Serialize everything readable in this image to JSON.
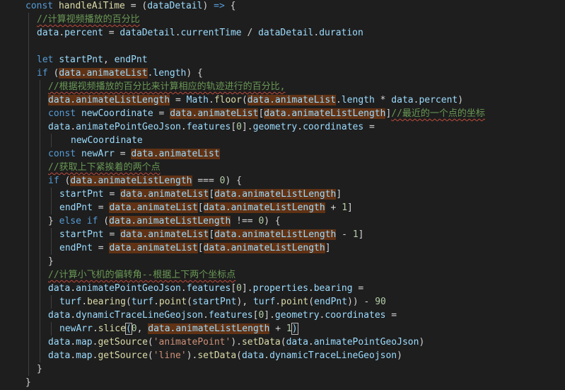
{
  "editor": {
    "theme_colors": {
      "background": "#1e1e1e",
      "keyword": "#569cd6",
      "function": "#dcdcaa",
      "variable": "#9cdcfe",
      "comment": "#6a9955",
      "string": "#ce9178",
      "number": "#b5cea8",
      "highlight": "#613214"
    },
    "lines": [
      {
        "indent": 0,
        "tokens": [
          [
            "kw",
            "const "
          ],
          [
            "fn",
            "handleAiTime"
          ],
          [
            "op",
            " = ("
          ],
          [
            "var",
            "dataDetail"
          ],
          [
            "op",
            ") "
          ],
          [
            "kw",
            "=>"
          ],
          [
            "op",
            " {"
          ]
        ]
      },
      {
        "indent": 1,
        "tokens": [
          [
            "cm",
            "//计算视频播放的百分比"
          ]
        ]
      },
      {
        "indent": 1,
        "tokens": [
          [
            "var",
            "data"
          ],
          [
            "op",
            "."
          ],
          [
            "prop",
            "percent"
          ],
          [
            "op",
            " = "
          ],
          [
            "var",
            "dataDetail"
          ],
          [
            "op",
            "."
          ],
          [
            "prop",
            "currentTime"
          ],
          [
            "op",
            " / "
          ],
          [
            "var",
            "dataDetail"
          ],
          [
            "op",
            "."
          ],
          [
            "prop",
            "duration"
          ]
        ]
      },
      {
        "indent": 1,
        "tokens": []
      },
      {
        "indent": 1,
        "tokens": [
          [
            "kw",
            "let "
          ],
          [
            "var",
            "startPnt"
          ],
          [
            "op",
            ", "
          ],
          [
            "var",
            "endPnt"
          ]
        ]
      },
      {
        "indent": 1,
        "tokens": [
          [
            "kw",
            "if"
          ],
          [
            "op",
            " ("
          ],
          [
            "hl",
            "data.animateList"
          ],
          [
            "op",
            "."
          ],
          [
            "prop",
            "length"
          ],
          [
            "op",
            ") {"
          ]
        ]
      },
      {
        "indent": 2,
        "tokens": [
          [
            "cm",
            "//根据视频播放的百分比来计算相应的轨迹进行的百分比,"
          ]
        ]
      },
      {
        "indent": 2,
        "tokens": [
          [
            "hl",
            "data.animateListLength"
          ],
          [
            "op",
            " = "
          ],
          [
            "var",
            "Math"
          ],
          [
            "op",
            "."
          ],
          [
            "fn",
            "floor"
          ],
          [
            "op",
            "("
          ],
          [
            "hl",
            "data.animateList"
          ],
          [
            "op",
            "."
          ],
          [
            "prop",
            "length"
          ],
          [
            "op",
            " * "
          ],
          [
            "var",
            "data"
          ],
          [
            "op",
            "."
          ],
          [
            "prop",
            "percent"
          ],
          [
            "op",
            ")"
          ]
        ]
      },
      {
        "indent": 2,
        "tokens": [
          [
            "kw",
            "const "
          ],
          [
            "var",
            "newCoordinate"
          ],
          [
            "op",
            " = "
          ],
          [
            "hl",
            "data.animateList"
          ],
          [
            "op",
            "["
          ],
          [
            "hl",
            "data.animateListLength"
          ],
          [
            "op",
            "]"
          ],
          [
            "cm",
            "//最近的一个点的坐标"
          ]
        ]
      },
      {
        "indent": 2,
        "tokens": [
          [
            "var",
            "data"
          ],
          [
            "op",
            "."
          ],
          [
            "prop",
            "animatePointGeoJson"
          ],
          [
            "op",
            "."
          ],
          [
            "prop",
            "features"
          ],
          [
            "op",
            "["
          ],
          [
            "num",
            "0"
          ],
          [
            "op",
            "]."
          ],
          [
            "prop",
            "geometry"
          ],
          [
            "op",
            "."
          ],
          [
            "prop",
            "coordinates"
          ],
          [
            "op",
            " ="
          ]
        ]
      },
      {
        "indent": 4,
        "tokens": [
          [
            "var",
            "newCoordinate"
          ]
        ]
      },
      {
        "indent": 2,
        "tokens": [
          [
            "kw",
            "const "
          ],
          [
            "var",
            "newArr"
          ],
          [
            "op",
            " = "
          ],
          [
            "hl",
            "data.animateList"
          ]
        ]
      },
      {
        "indent": 2,
        "tokens": [
          [
            "cm",
            "//获取上下紧挨着的两个点"
          ]
        ]
      },
      {
        "indent": 2,
        "tokens": [
          [
            "kw",
            "if"
          ],
          [
            "op",
            " ("
          ],
          [
            "hl",
            "data.animateListLength"
          ],
          [
            "op",
            " === "
          ],
          [
            "num",
            "0"
          ],
          [
            "op",
            ") {"
          ]
        ]
      },
      {
        "indent": 3,
        "tokens": [
          [
            "var",
            "startPnt"
          ],
          [
            "op",
            " = "
          ],
          [
            "hl",
            "data.animateList"
          ],
          [
            "op",
            "["
          ],
          [
            "hl",
            "data.animateListLength"
          ],
          [
            "op",
            "]"
          ]
        ]
      },
      {
        "indent": 3,
        "tokens": [
          [
            "var",
            "endPnt"
          ],
          [
            "op",
            " = "
          ],
          [
            "hl",
            "data.animateList"
          ],
          [
            "op",
            "["
          ],
          [
            "hl",
            "data.animateListLength"
          ],
          [
            "op",
            " + "
          ],
          [
            "num",
            "1"
          ],
          [
            "op",
            "]"
          ]
        ]
      },
      {
        "indent": 2,
        "tokens": [
          [
            "op",
            "} "
          ],
          [
            "kw",
            "else if"
          ],
          [
            "op",
            " ("
          ],
          [
            "hl",
            "data.animateListLength"
          ],
          [
            "op",
            " !== "
          ],
          [
            "num",
            "0"
          ],
          [
            "op",
            ") {"
          ]
        ]
      },
      {
        "indent": 3,
        "tokens": [
          [
            "var",
            "startPnt"
          ],
          [
            "op",
            " = "
          ],
          [
            "hl",
            "data.animateList"
          ],
          [
            "op",
            "["
          ],
          [
            "hl",
            "data.animateListLength"
          ],
          [
            "op",
            " - "
          ],
          [
            "num",
            "1"
          ],
          [
            "op",
            "]"
          ]
        ]
      },
      {
        "indent": 3,
        "tokens": [
          [
            "var",
            "endPnt"
          ],
          [
            "op",
            " = "
          ],
          [
            "hl",
            "data.animateList"
          ],
          [
            "op",
            "["
          ],
          [
            "hl",
            "data.animateListLength"
          ],
          [
            "op",
            "]"
          ]
        ]
      },
      {
        "indent": 2,
        "tokens": [
          [
            "op",
            "}"
          ]
        ]
      },
      {
        "indent": 2,
        "tokens": [
          [
            "cm",
            "//计算小飞机的偏转角--根据上下两个坐标点"
          ]
        ]
      },
      {
        "indent": 2,
        "tokens": [
          [
            "var",
            "data"
          ],
          [
            "op",
            "."
          ],
          [
            "prop",
            "animatePointGeoJson"
          ],
          [
            "op",
            "."
          ],
          [
            "prop",
            "features"
          ],
          [
            "op",
            "["
          ],
          [
            "num",
            "0"
          ],
          [
            "op",
            "]."
          ],
          [
            "prop",
            "properties"
          ],
          [
            "op",
            "."
          ],
          [
            "prop",
            "bearing"
          ],
          [
            "op",
            " ="
          ]
        ]
      },
      {
        "indent": 3,
        "tokens": [
          [
            "var",
            "turf"
          ],
          [
            "op",
            "."
          ],
          [
            "fn",
            "bearing"
          ],
          [
            "op",
            "("
          ],
          [
            "var",
            "turf"
          ],
          [
            "op",
            "."
          ],
          [
            "fn",
            "point"
          ],
          [
            "op",
            "("
          ],
          [
            "var",
            "startPnt"
          ],
          [
            "op",
            "), "
          ],
          [
            "var",
            "turf"
          ],
          [
            "op",
            "."
          ],
          [
            "fn",
            "point"
          ],
          [
            "op",
            "("
          ],
          [
            "var",
            "endPnt"
          ],
          [
            "op",
            ")) - "
          ],
          [
            "num",
            "90"
          ]
        ]
      },
      {
        "indent": 2,
        "tokens": [
          [
            "var",
            "data"
          ],
          [
            "op",
            "."
          ],
          [
            "prop",
            "dynamicTraceLineGeojson"
          ],
          [
            "op",
            "."
          ],
          [
            "prop",
            "features"
          ],
          [
            "op",
            "["
          ],
          [
            "num",
            "0"
          ],
          [
            "op",
            "]."
          ],
          [
            "prop",
            "geometry"
          ],
          [
            "op",
            "."
          ],
          [
            "prop",
            "coordinates"
          ],
          [
            "op",
            " ="
          ]
        ]
      },
      {
        "indent": 3,
        "tokens": [
          [
            "var",
            "newArr"
          ],
          [
            "op",
            "."
          ],
          [
            "fn",
            "slice"
          ],
          [
            "sel",
            "("
          ],
          [
            "num",
            "0"
          ],
          [
            "op",
            ", "
          ],
          [
            "hl",
            "data.animateListLength"
          ],
          [
            "op",
            " + "
          ],
          [
            "num",
            "1"
          ],
          [
            "sel",
            ")"
          ]
        ]
      },
      {
        "indent": 2,
        "tokens": [
          [
            "var",
            "data"
          ],
          [
            "op",
            "."
          ],
          [
            "prop",
            "map"
          ],
          [
            "op",
            "."
          ],
          [
            "fn",
            "getSource"
          ],
          [
            "op",
            "("
          ],
          [
            "str",
            "'animatePoint'"
          ],
          [
            "op",
            ")."
          ],
          [
            "fn",
            "setData"
          ],
          [
            "op",
            "("
          ],
          [
            "var",
            "data"
          ],
          [
            "op",
            "."
          ],
          [
            "prop",
            "animatePointGeoJson"
          ],
          [
            "op",
            ")"
          ]
        ]
      },
      {
        "indent": 2,
        "tokens": [
          [
            "var",
            "data"
          ],
          [
            "op",
            "."
          ],
          [
            "prop",
            "map"
          ],
          [
            "op",
            "."
          ],
          [
            "fn",
            "getSource"
          ],
          [
            "op",
            "("
          ],
          [
            "str",
            "'line'"
          ],
          [
            "op",
            ")."
          ],
          [
            "fn",
            "setData"
          ],
          [
            "op",
            "("
          ],
          [
            "var",
            "data"
          ],
          [
            "op",
            "."
          ],
          [
            "prop",
            "dynamicTraceLineGeojson"
          ],
          [
            "op",
            ")"
          ]
        ]
      },
      {
        "indent": 1,
        "tokens": [
          [
            "op",
            "}"
          ]
        ]
      },
      {
        "indent": 0,
        "tokens": [
          [
            "op",
            "}"
          ]
        ]
      }
    ]
  }
}
